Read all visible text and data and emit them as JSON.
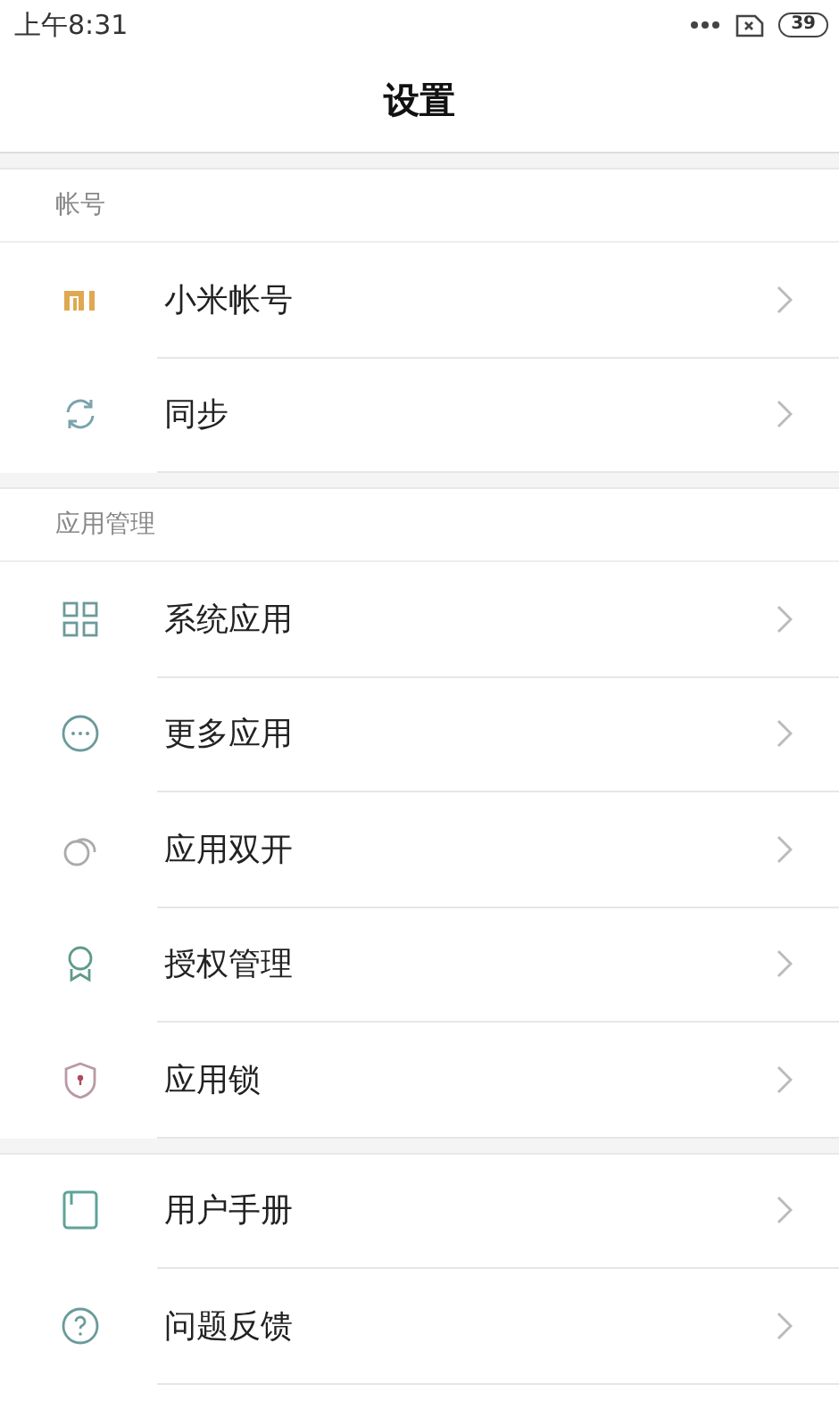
{
  "status_bar": {
    "time": "上午8:31",
    "battery": "39"
  },
  "title": "设置",
  "sections": [
    {
      "header": "帐号",
      "items": [
        {
          "kind": "mi",
          "label": "小米帐号"
        },
        {
          "kind": "sync",
          "label": "同步"
        }
      ]
    },
    {
      "header": "应用管理",
      "items": [
        {
          "kind": "grid",
          "label": "系统应用"
        },
        {
          "kind": "more",
          "label": "更多应用"
        },
        {
          "kind": "dual",
          "label": "应用双开"
        },
        {
          "kind": "badge",
          "label": "授权管理"
        },
        {
          "kind": "shield",
          "label": "应用锁"
        }
      ]
    },
    {
      "items": [
        {
          "kind": "book",
          "label": "用户手册"
        },
        {
          "kind": "help",
          "label": "问题反馈"
        }
      ]
    }
  ]
}
